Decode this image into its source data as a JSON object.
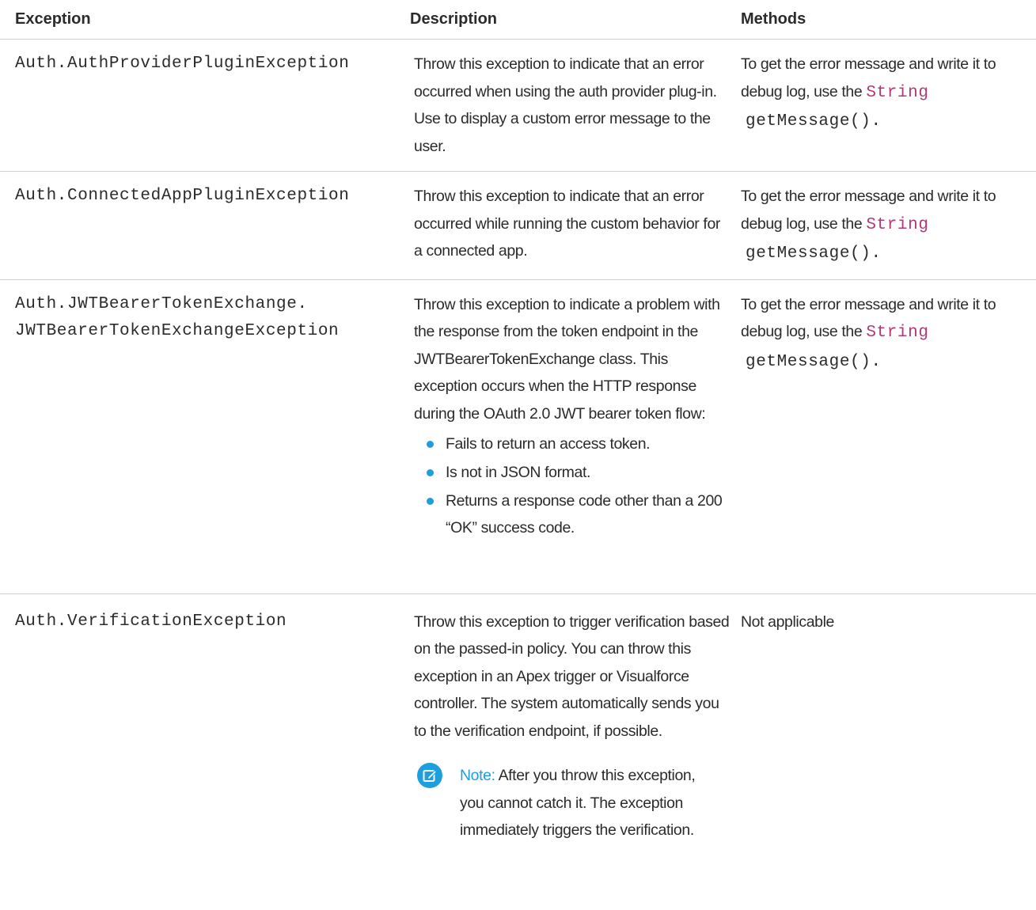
{
  "colors": {
    "text": "#2b2b2b",
    "type_keyword": "#b03a76",
    "accent": "#1c9fdc",
    "rule": "#cfcfcf"
  },
  "table": {
    "headers": [
      "Exception",
      "Description",
      "Methods"
    ],
    "rows": [
      {
        "exception": [
          "Auth.AuthProviderPluginException"
        ],
        "description": "Throw this exception to indicate that an error occurred when using the auth provider plug-in. Use to display a custom error message to the user.",
        "methods": {
          "text": "To get the error message and write it to debug log, use the",
          "type": "String",
          "call": "getMessage()",
          "end": "."
        }
      },
      {
        "exception": [
          "Auth.ConnectedAppPluginException"
        ],
        "description": "Throw this exception to indicate that an error occurred while running the custom behavior for a connected app.",
        "methods": {
          "text": "To get the error message and write it to debug log, use the",
          "type": "String",
          "call": "getMessage()",
          "end": "."
        }
      },
      {
        "exception": [
          "Auth.JWTBearerTokenExchange.",
          "JWTBearerTokenExchangeException"
        ],
        "description": "Throw this exception to indicate a problem with the response from the token endpoint in the JWTBearerTokenExchange class. This exception occurs when the HTTP response during the OAuth 2.0 JWT bearer token flow:",
        "bullets": [
          "Fails to return an access token.",
          "Is not in JSON format.",
          "Returns a response code other than a 200 “OK” success code."
        ],
        "methods": {
          "text": "To get the error message and write it to debug log, use the",
          "type": "String",
          "call": "getMessage()",
          "end": "."
        }
      },
      {
        "exception": [
          "Auth.VerificationException"
        ],
        "description": "Throw this exception to trigger verification based on the passed-in policy. You can throw this exception in an Apex trigger or Visualforce controller. The system automatically sends you to the verification endpoint, if possible.",
        "note": {
          "icon": "edit-note-icon",
          "label": "Note:",
          "text": "After you throw this exception, you cannot catch it. The exception immediately triggers the verification."
        },
        "methods_plain": "Not applicable"
      }
    ]
  }
}
